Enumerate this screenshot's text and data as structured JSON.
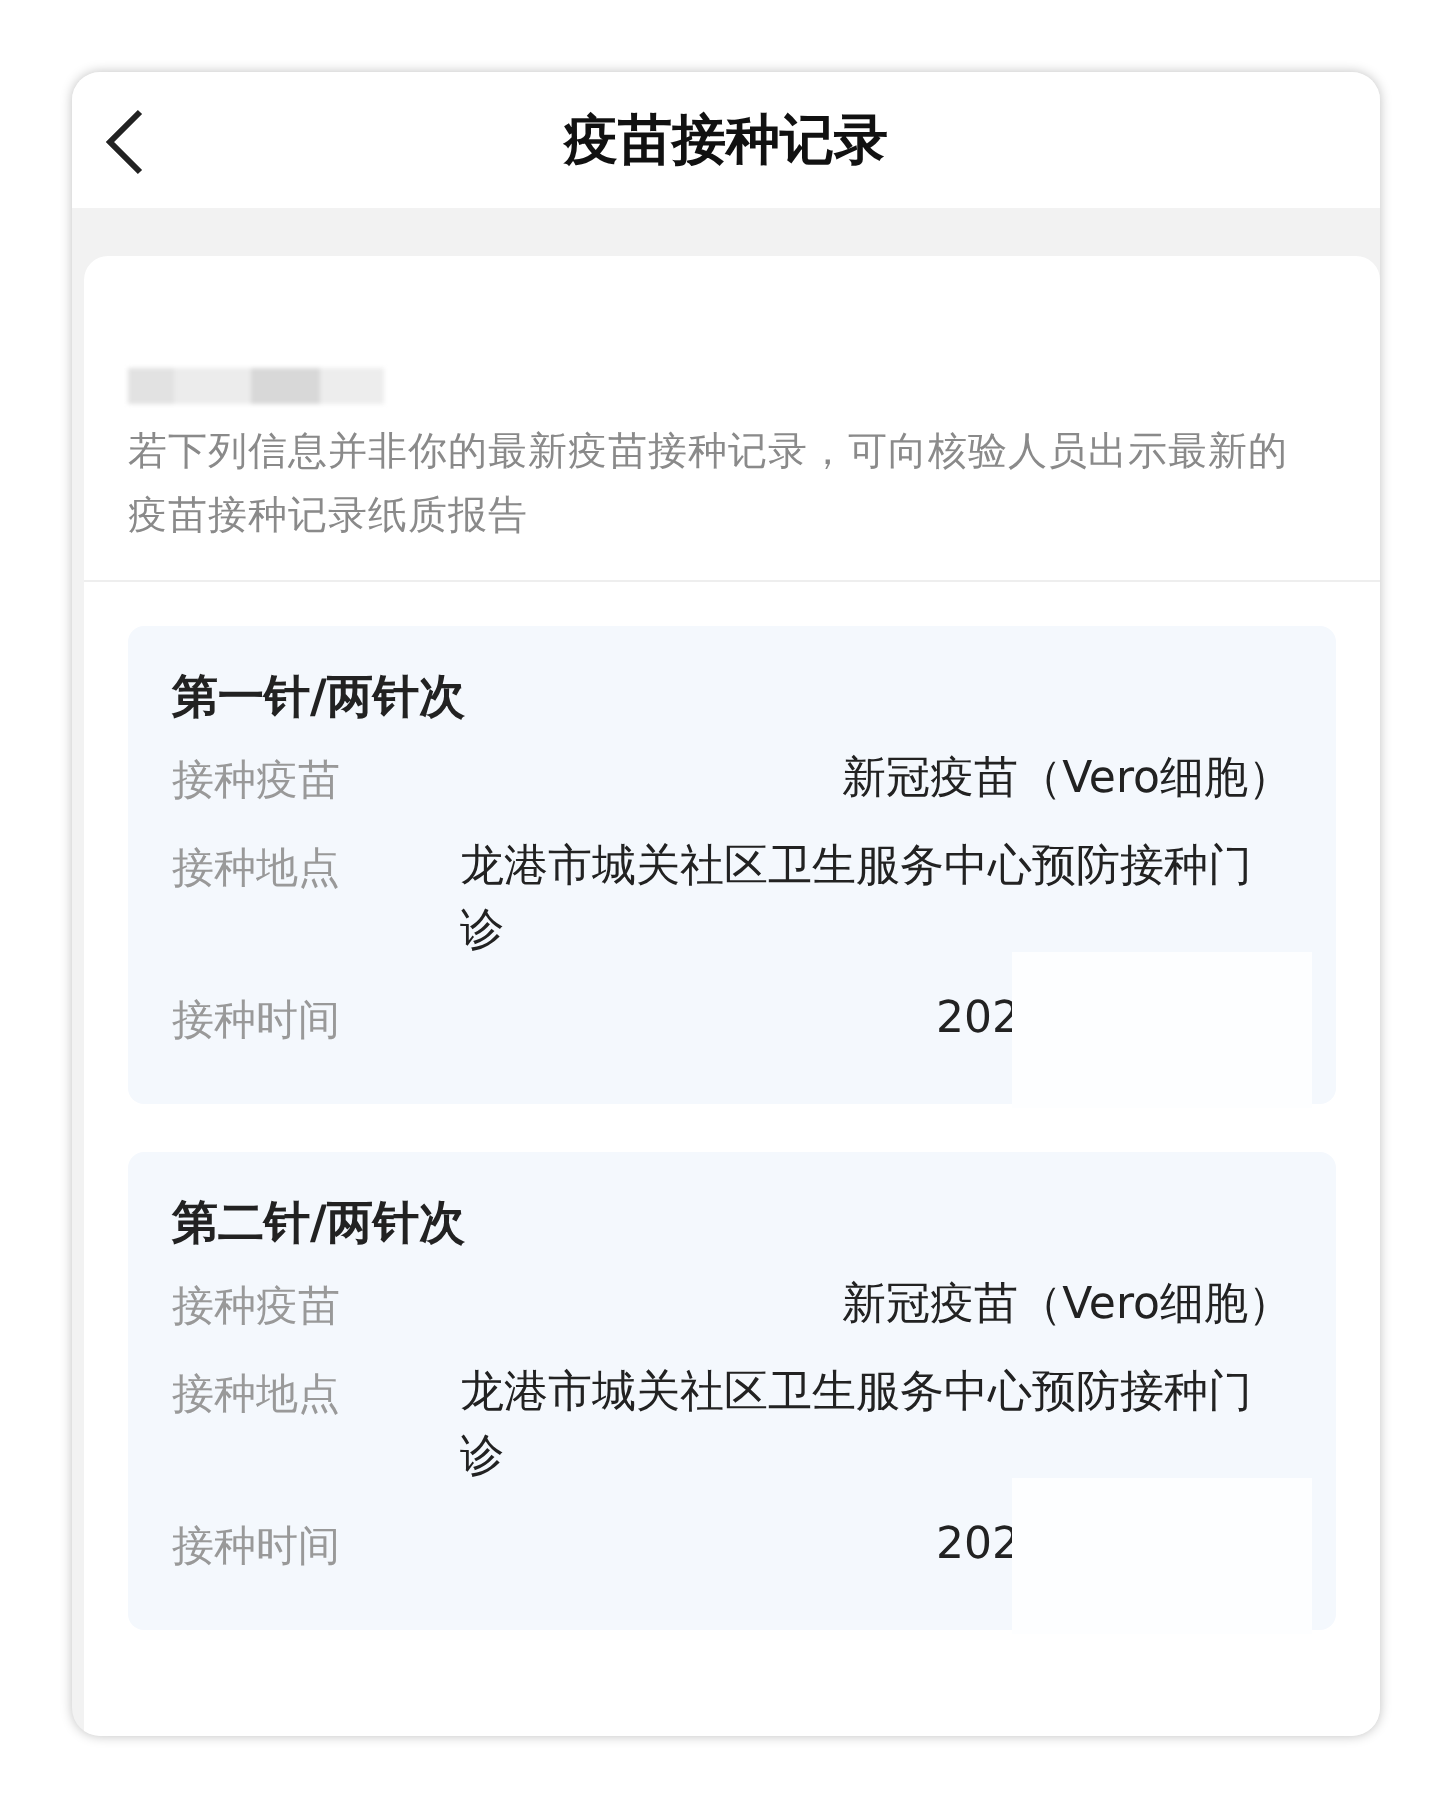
{
  "header": {
    "title": "疫苗接种记录"
  },
  "notice": {
    "text": "若下列信息并非你的最新疫苗接种记录，可向核验人员出示最新的疫苗接种记录纸质报告"
  },
  "records": [
    {
      "title": "第一针/两针次",
      "rows": [
        {
          "label": "接种疫苗",
          "value": "新冠疫苗（Vero细胞）"
        },
        {
          "label": "接种地点",
          "value": "龙港市城关社区卫生服务中心预防接种门诊"
        },
        {
          "label": "接种时间",
          "value": "202",
          "redacted": true
        }
      ]
    },
    {
      "title": "第二针/两针次",
      "rows": [
        {
          "label": "接种疫苗",
          "value": "新冠疫苗（Vero细胞）"
        },
        {
          "label": "接种地点",
          "value": "龙港市城关社区卫生服务中心预防接种门诊"
        },
        {
          "label": "接种时间",
          "value": "202",
          "redacted": true
        }
      ]
    }
  ]
}
